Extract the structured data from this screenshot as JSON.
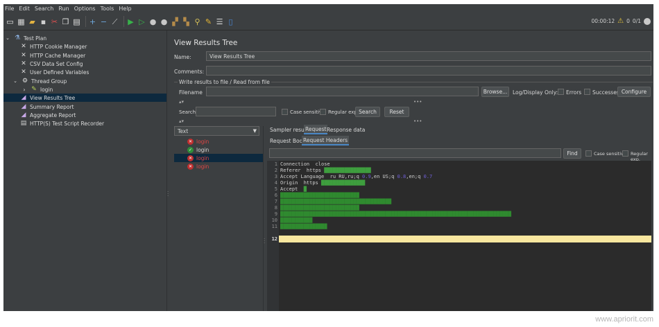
{
  "menubar": [
    "File",
    "Edit",
    "Search",
    "Run",
    "Options",
    "Tools",
    "Help"
  ],
  "toolbar": {
    "buttons": [
      "new-icon",
      "templates-icon",
      "open-icon",
      "save-icon",
      "cut-icon",
      "copy-icon",
      "paste-icon",
      "expand-icon",
      "collapse-icon",
      "toggle-icon",
      "start-icon",
      "start-no-pauses-icon",
      "stop-icon",
      "shutdown-icon",
      "clear-icon",
      "clear-all-icon",
      "search-icon",
      "reset-search-icon",
      "function-helper-icon",
      "help-icon"
    ],
    "timer": "00:00:12",
    "warning_count": "0",
    "threads": "0/1"
  },
  "tree": {
    "items": [
      {
        "label": "Test Plan",
        "icon": "test-plan-icon",
        "level": 0,
        "expanded": true
      },
      {
        "label": "HTTP Cookie Manager",
        "icon": "config-element-icon",
        "level": 1
      },
      {
        "label": "HTTP Cache Manager",
        "icon": "config-element-icon",
        "level": 1
      },
      {
        "label": "CSV Data Set Config",
        "icon": "config-element-icon",
        "level": 1
      },
      {
        "label": "User Defined Variables",
        "icon": "config-element-icon",
        "level": 1
      },
      {
        "label": "Thread Group",
        "icon": "thread-group-icon",
        "level": 1,
        "expanded": true
      },
      {
        "label": "login",
        "icon": "sampler-icon",
        "level": 2,
        "collapsed": true
      },
      {
        "label": "View Results Tree",
        "icon": "listener-icon",
        "level": 1,
        "selected": true
      },
      {
        "label": "Summary Report",
        "icon": "listener-icon",
        "level": 1
      },
      {
        "label": "Aggregate Report",
        "icon": "listener-icon",
        "level": 1
      },
      {
        "label": "HTTP(S) Test Script Recorder",
        "icon": "recorder-icon",
        "level": 1
      }
    ]
  },
  "panel": {
    "title": "View Results Tree",
    "name_label": "Name:",
    "name_value": "View Results Tree",
    "comments_label": "Comments:",
    "comments_value": "",
    "write_results_label": "Write results to file / Read from file",
    "filename_label": "Filename",
    "filename_value": "",
    "browse_label": "Browse...",
    "logdisplay_label": "Log/Display Only:",
    "errors_label": "Errors",
    "successes_label": "Successes",
    "configure_label": "Configure",
    "search_label": "Search:",
    "search_value": "",
    "case_sensitive_label": "Case sensitive",
    "regex_label": "Regular exp.",
    "search_button": "Search",
    "reset_button": "Reset"
  },
  "results": {
    "renderer": "Text",
    "samples": [
      {
        "label": "login",
        "status": "error"
      },
      {
        "label": "login",
        "status": "ok"
      },
      {
        "label": "login",
        "status": "error",
        "selected": true
      },
      {
        "label": "login",
        "status": "error"
      }
    ]
  },
  "detail": {
    "tabs": [
      "Sampler result",
      "Request",
      "Response data"
    ],
    "active_tab": "Request",
    "subtabs": [
      "Request Body",
      "Request Headers"
    ],
    "active_subtab": "Request Headers",
    "find_value": "",
    "find_button": "Find",
    "case_sensitive_label": "Case sensitive",
    "regex_label": "Regular exp.",
    "lines": [
      {
        "n": "1",
        "key": "Connection  close",
        "val": ""
      },
      {
        "n": "2",
        "key": "Referer  https",
        "val": ""
      },
      {
        "n": "3",
        "key": "Accept Language  ru RU,ru;q ",
        "num1": "0.9",
        "mid": ",en US;q ",
        "num2": "0.8",
        "tail": ",en;q ",
        "num3": "0.7"
      },
      {
        "n": "4",
        "key": "Origin  https",
        "val": ""
      },
      {
        "n": "5",
        "key": "Accept  ",
        "val": ""
      },
      {
        "n": "6",
        "key": "",
        "full": ""
      },
      {
        "n": "7",
        "key": "",
        "full": ""
      },
      {
        "n": "8",
        "key": "",
        "full": ""
      },
      {
        "n": "9",
        "key": "",
        "full": ""
      },
      {
        "n": "10",
        "key": "",
        "full": ""
      },
      {
        "n": "11",
        "key": "",
        "full": ""
      },
      {
        "n": "12",
        "key": "",
        "current": true
      }
    ]
  },
  "watermark": "www.apriorit.com"
}
